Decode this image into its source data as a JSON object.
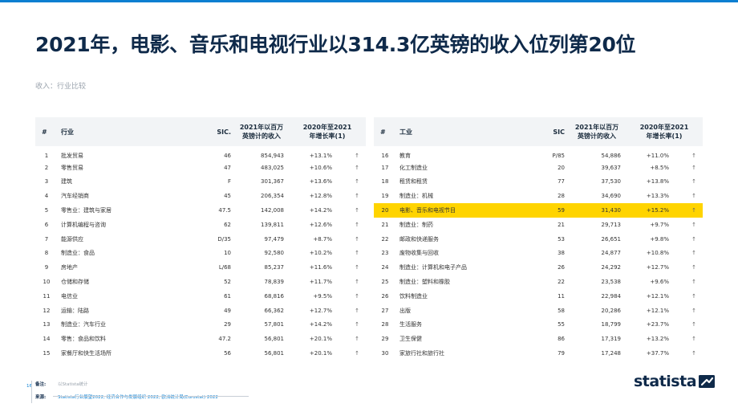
{
  "title": "2021年，电影、音乐和电视行业以314.3亿英镑的收入位列第20位",
  "subtitle": "收入：行业比较",
  "left_table": {
    "headers": {
      "num": "#",
      "name": "行业",
      "sic": "SIC.",
      "rev": "2021年以百万\n英镑计的收入",
      "growth": "2020年至2021\n年增长率(1)"
    },
    "rows": [
      {
        "num": "1",
        "name": "批发贸易",
        "sic": "46",
        "rev": "854,943",
        "growth": "+13.1%",
        "arrow": "↑"
      },
      {
        "num": "2",
        "name": "零售贸易",
        "sic": "47",
        "rev": "483,025",
        "growth": "+10.6%",
        "arrow": "↑"
      },
      {
        "num": "3",
        "name": "建筑",
        "sic": "F",
        "rev": "301,367",
        "growth": "+13.6%",
        "arrow": "↑"
      },
      {
        "num": "4",
        "name": "汽车经销商",
        "sic": "45",
        "rev": "206,354",
        "growth": "+12.8%",
        "arrow": "↑"
      },
      {
        "num": "5",
        "name": "零售业：建筑与家居",
        "sic": "47.5",
        "rev": "142,008",
        "growth": "+14.2%",
        "arrow": "↑"
      },
      {
        "num": "6",
        "name": "计算机编程与咨询",
        "sic": "62",
        "rev": "139,811",
        "growth": "+12.6%",
        "arrow": "↑"
      },
      {
        "num": "7",
        "name": "能源供应",
        "sic": "D/35",
        "rev": "97,479",
        "growth": "+8.7%",
        "arrow": "↑"
      },
      {
        "num": "8",
        "name": "制造业：食品",
        "sic": "10",
        "rev": "92,580",
        "growth": "+10.2%",
        "arrow": "↑"
      },
      {
        "num": "9",
        "name": "房地产",
        "sic": "L/68",
        "rev": "85,237",
        "growth": "+11.6%",
        "arrow": "↑"
      },
      {
        "num": "10",
        "name": "仓储和存储",
        "sic": "52",
        "rev": "78,839",
        "growth": "+11.7%",
        "arrow": "↑"
      },
      {
        "num": "11",
        "name": "电信业",
        "sic": "61",
        "rev": "68,816",
        "growth": "+9.5%",
        "arrow": "↑"
      },
      {
        "num": "12",
        "name": "运输：陆路",
        "sic": "49",
        "rev": "66,362",
        "growth": "+12.7%",
        "arrow": "↑"
      },
      {
        "num": "13",
        "name": "制造业：汽车行业",
        "sic": "29",
        "rev": "57,801",
        "growth": "+14.2%",
        "arrow": "↑"
      },
      {
        "num": "14",
        "name": "零售：食品和饮料",
        "sic": "47.2",
        "rev": "56,801",
        "growth": "+20.1%",
        "arrow": "↑"
      },
      {
        "num": "15",
        "name": "家餐厅和快生活场所",
        "sic": "56",
        "rev": "56,801",
        "growth": "+20.1%",
        "arrow": "↑"
      }
    ]
  },
  "right_table": {
    "headers": {
      "num": "#",
      "name": "工业",
      "sic": "SIC",
      "rev": "2021年以百万\n英镑计的收入",
      "growth": "2020年至2021\n年增长率(1)"
    },
    "rows": [
      {
        "num": "16",
        "name": "教育",
        "sic": "P/85",
        "rev": "54,886",
        "growth": "+11.0%",
        "arrow": "↑",
        "highlight": false
      },
      {
        "num": "17",
        "name": "化工制造业",
        "sic": "20",
        "rev": "39,637",
        "growth": "+8.5%",
        "arrow": "↑",
        "highlight": false
      },
      {
        "num": "18",
        "name": "租赁和租赁",
        "sic": "77",
        "rev": "37,530",
        "growth": "+13.8%",
        "arrow": "↑",
        "highlight": false
      },
      {
        "num": "19",
        "name": "制造业：机械",
        "sic": "28",
        "rev": "34,690",
        "growth": "+13.3%",
        "arrow": "↑",
        "highlight": false
      },
      {
        "num": "20",
        "name": "电影、音乐和电视节目",
        "sic": "59",
        "rev": "31,430",
        "growth": "+15.2%",
        "arrow": "↑",
        "highlight": true
      },
      {
        "num": "21",
        "name": "制造业：制药",
        "sic": "21",
        "rev": "29,713",
        "growth": "+9.7%",
        "arrow": "↑",
        "highlight": false
      },
      {
        "num": "22",
        "name": "邮政和快递服务",
        "sic": "53",
        "rev": "26,651",
        "growth": "+9.8%",
        "arrow": "↑",
        "highlight": false
      },
      {
        "num": "23",
        "name": "废物收集与回收",
        "sic": "38",
        "rev": "24,877",
        "growth": "+10.8%",
        "arrow": "↑",
        "highlight": false
      },
      {
        "num": "24",
        "name": "制造业：计算机和电子产品",
        "sic": "26",
        "rev": "24,292",
        "growth": "+12.7%",
        "arrow": "↑",
        "highlight": false
      },
      {
        "num": "25",
        "name": "制造业：塑料和橡胶",
        "sic": "22",
        "rev": "23,538",
        "growth": "+9.6%",
        "arrow": "↑",
        "highlight": false
      },
      {
        "num": "26",
        "name": "饮料制造业",
        "sic": "11",
        "rev": "22,984",
        "growth": "+12.1%",
        "arrow": "↑",
        "highlight": false
      },
      {
        "num": "27",
        "name": "出版",
        "sic": "58",
        "rev": "20,286",
        "growth": "+12.1%",
        "arrow": "↑",
        "highlight": false
      },
      {
        "num": "28",
        "name": "生活服务",
        "sic": "55",
        "rev": "18,799",
        "growth": "+23.7%",
        "arrow": "↑",
        "highlight": false
      },
      {
        "num": "29",
        "name": "卫生保健",
        "sic": "86",
        "rev": "17,319",
        "growth": "+13.2%",
        "arrow": "↑",
        "highlight": false
      },
      {
        "num": "30",
        "name": "家旅行社和旅行社",
        "sic": "79",
        "rev": "17,248",
        "growth": "+37.7%",
        "arrow": "↑",
        "highlight": false
      }
    ]
  },
  "footer": {
    "page_number": "16",
    "note_label": "备注:",
    "note_value": "以Statista统计",
    "source_label": "来源:",
    "source_value": "Statista行业展望2022, 经济合作与发展组织 2022, 欧洲统计局(Eurostat) 2022"
  },
  "logo": {
    "text": "statista",
    "icon": "statista-logo-mark-icon",
    "color": "#0f2a4a"
  },
  "colors": {
    "accent": "#0b7fd1",
    "highlight": "#ffd400",
    "title": "#0f2a4a"
  }
}
